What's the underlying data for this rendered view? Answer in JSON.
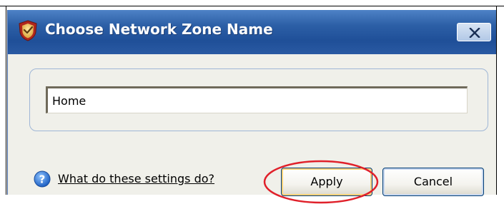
{
  "window": {
    "title": "Choose Network Zone Name",
    "icon": "shield-app-icon",
    "close_icon": "close-x-icon"
  },
  "form": {
    "zone_name_value": "Home"
  },
  "footer": {
    "help_icon": "help-question-icon",
    "help_link": "What do these settings do?",
    "apply_label": "Apply",
    "cancel_label": "Cancel"
  },
  "annotation": {
    "highlight_color": "#e0202a",
    "highlighted_element": "Apply"
  }
}
